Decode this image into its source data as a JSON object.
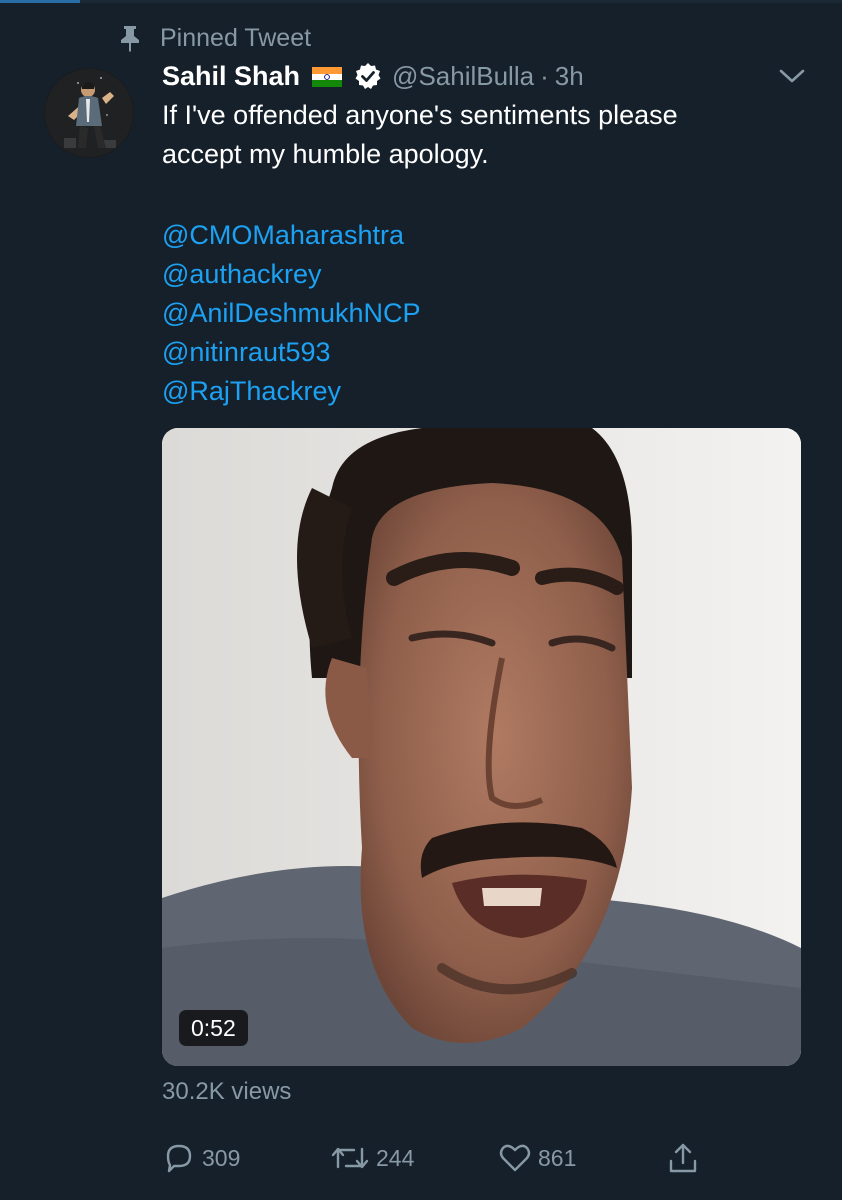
{
  "pinned": {
    "label": "Pinned Tweet"
  },
  "tweet": {
    "display_name": "Sahil Shah",
    "flag_emoji": "🇮🇳",
    "verified": true,
    "handle": "@SahilBulla",
    "separator": "·",
    "time": "3h",
    "text_lines": [
      "If I've offended anyone's sentiments please",
      "accept my humble apology."
    ],
    "mentions": [
      "@CMOMaharashtra",
      "@authackrey",
      "@AnilDeshmukhNCP",
      "@nitinraut593",
      "@RajThackrey"
    ],
    "video": {
      "duration": "0:52"
    },
    "views": "30.2K views",
    "stats": {
      "replies": "309",
      "retweets": "244",
      "likes": "861"
    }
  },
  "icons": {
    "pin": "pin-icon",
    "verified": "verified-badge-icon",
    "caret": "chevron-down-icon",
    "reply": "reply-bubble-icon",
    "retweet": "retweet-icon",
    "like": "heart-icon",
    "share": "share-upload-icon"
  },
  "colors": {
    "background": "#15202b",
    "secondary_text": "#8899a6",
    "link": "#1da1f2",
    "primary_text": "#ffffff"
  }
}
